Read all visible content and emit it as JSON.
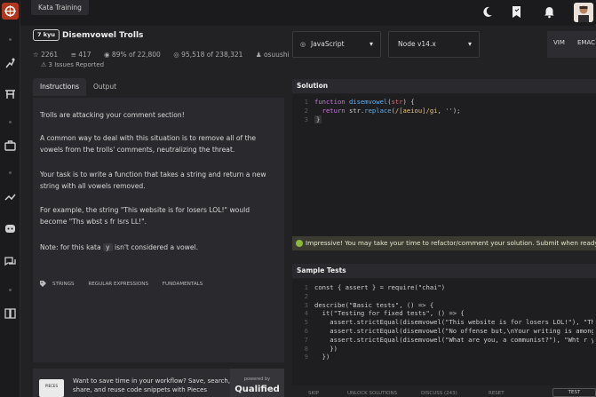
{
  "topbar": {
    "breadcrumb": "Kata Training"
  },
  "kata": {
    "rank": "7 kyu",
    "title": "Disemvowel Trolls",
    "stats": {
      "points": "2261",
      "collections": "417",
      "satisfaction": "89% of 22,800",
      "completions": "95,518 of 238,321",
      "author": "osuushi"
    },
    "issues": "3 Issues Reported"
  },
  "tabs": [
    {
      "label": "Instructions"
    },
    {
      "label": "Output"
    }
  ],
  "selects": {
    "language": "JavaScript",
    "version": "Node v14.x"
  },
  "modes": {
    "vim": "VIM",
    "emacs": "EMAC"
  },
  "instructions": {
    "p1": "Trolls are attacking your comment section!",
    "p2": "A common way to deal with this situation is to remove all of the vowels from the trolls' comments, neutralizing the threat.",
    "p3": "Your task is to write a function that takes a string and return a new string with all vowels removed.",
    "p4": "For example, the string \"This website is for losers LOL!\" would become \"Ths wbst s fr lsrs LL!\".",
    "p5_before": "Note: for this kata",
    "p5_code": "y",
    "p5_after": "isn't considered a vowel."
  },
  "tags": [
    "STRINGS",
    "REGULAR EXPRESSIONS",
    "FUNDAMENTALS"
  ],
  "promo": {
    "logo_text": "PIECES",
    "text": "Want to save time in your workflow? Save, search, share, and reuse code snippets with Pieces",
    "powered_small": "powered by",
    "powered_brand": "Qualified"
  },
  "solution": {
    "title": "Solution",
    "lines": [
      {
        "n": "1",
        "code": "function disemvowel(str) {"
      },
      {
        "n": "2",
        "code": "  return str.replace(/[aeiou]/gi, '');"
      },
      {
        "n": "3",
        "code": "}"
      }
    ]
  },
  "impressive": "Impressive! You may take your time to refactor/comment your solution. Submit when ready.",
  "sample_tests": {
    "title": "Sample Tests",
    "lines": [
      {
        "n": "1",
        "code": "const { assert } = require(\"chai\")"
      },
      {
        "n": "2",
        "code": ""
      },
      {
        "n": "3",
        "code": "describe(\"Basic tests\", () => {"
      },
      {
        "n": "4",
        "code": "  it(\"Testing for fixed tests\", () => {"
      },
      {
        "n": "5",
        "code": "    assert.strictEqual(disemvowel(\"This website is for losers LOL!\"), \"Ths wbst s fr lsrs LL!\")"
      },
      {
        "n": "6",
        "code": "    assert.strictEqual(disemvowel(\"No offense but,\\nYour writing is among the worst I've ever read\"), \"N ffns bt,\\nYr wrtng s mng th wrst 'v vr rd\")"
      },
      {
        "n": "7",
        "code": "    assert.strictEqual(disemvowel(\"What are you, a communist?\"), \"Wht r y,  cmmnst?\")"
      },
      {
        "n": "8",
        "code": "    })"
      },
      {
        "n": "9",
        "code": "  })"
      }
    ]
  },
  "bottom": {
    "skip": "SKIP",
    "unlock": "UNLOCK SOLUTIONS",
    "discuss": "DISCUSS (243)",
    "reset": "RESET",
    "test": "TEST"
  },
  "colors": {
    "accent": "#b1361e",
    "success": "#8bb93b",
    "background": "#222224"
  }
}
